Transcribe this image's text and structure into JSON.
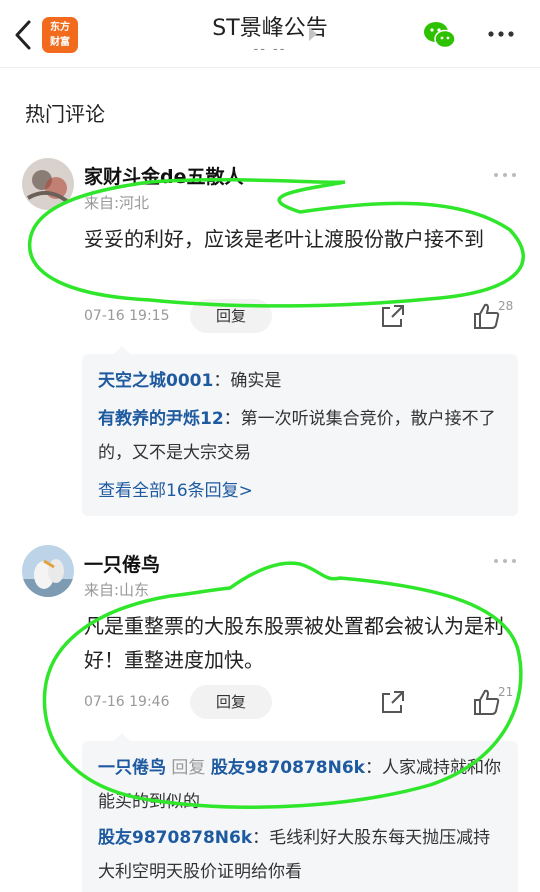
{
  "header": {
    "title": "ST景峰公告",
    "subtitle": "-- --",
    "logo_line1": "东方",
    "logo_line2": "财富"
  },
  "section_title": "热门评论",
  "comments": [
    {
      "username": "家财斗金de五散人",
      "location": "来自:河北",
      "content": "妥妥的利好，应该是老叶让渡股份散户接不到",
      "time": "07-16 19:15",
      "reply_label": "回复",
      "likes": "28",
      "replies": [
        {
          "name": "天空之城0001",
          "text": "：确实是"
        },
        {
          "name": "有教养的尹烁12",
          "text": "：第一次听说集合竞价，散户接不了的，又不是大宗交易"
        }
      ],
      "view_all": "查看全部16条回复>"
    },
    {
      "username": "一只倦鸟",
      "location": "来自:山东",
      "content": "凡是重整票的大股东股票被处置都会被认为是利好！重整进度加快。",
      "time": "07-16 19:46",
      "reply_label": "回复",
      "likes": "21",
      "replies": [
        {
          "name": "一只倦鸟",
          "mid": " 回复 ",
          "target": "股友9870878N6k",
          "text": "：人家减持就和你能买的到似的"
        },
        {
          "name": "股友9870878N6k",
          "text": "：毛线利好大股东每天抛压减持 大利空明天股价证明给你看"
        }
      ]
    }
  ],
  "icons": {
    "back": "chevron-left-icon",
    "wechat": "wechat-icon",
    "more": "more-icon",
    "share": "share-icon",
    "like": "thumbs-up-icon"
  },
  "colors": {
    "brand": "#f26a1b",
    "link": "#1e5aa0",
    "annotation": "#2fe62a",
    "wechat": "#2dc100"
  }
}
